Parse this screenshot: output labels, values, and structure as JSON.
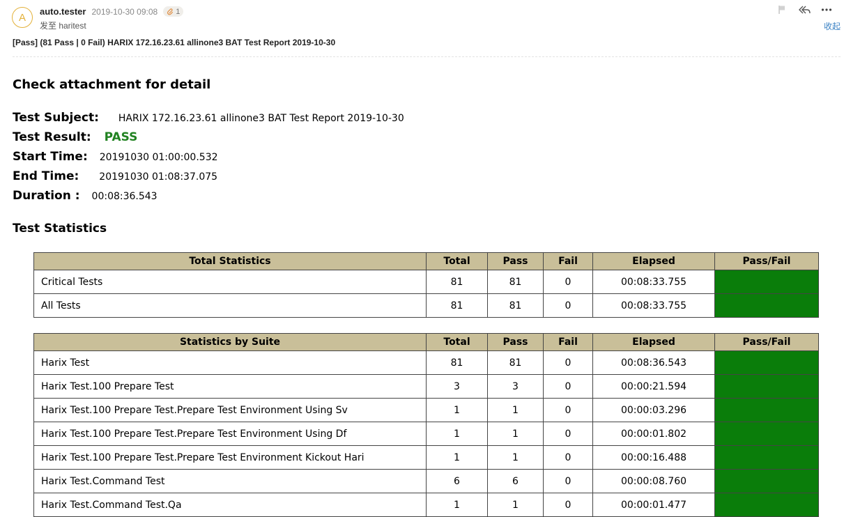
{
  "mail": {
    "avatar_letter": "A",
    "sender": "auto.tester",
    "time": "2019-10-30 09:08",
    "attachment_count": "1",
    "recipient": "发至 haritest",
    "subject": "[Pass] (81 Pass | 0 Fail) HARIX 172.16.23.61 allinone3 BAT Test Report 2019-10-30",
    "collapse_label": "收起",
    "icons": [
      "flag-icon",
      "reply-all-icon",
      "more-icon",
      "paperclip-icon"
    ]
  },
  "report": {
    "heading": "Check attachment for detail",
    "subject_label": "Test Subject:",
    "subject_value": "HARIX 172.16.23.61 allinone3 BAT Test Report 2019-10-30",
    "result_label": "Test Result:",
    "result_value": "PASS",
    "start_label": "Start Time:",
    "start_value": "20191030 01:00:00.532",
    "end_label": "End Time:",
    "end_value": "20191030 01:08:37.075",
    "duration_label": "Duration :",
    "duration_value": "00:08:36.543",
    "stats_heading": "Test Statistics"
  },
  "total_table": {
    "headers": [
      "Total Statistics",
      "Total",
      "Pass",
      "Fail",
      "Elapsed",
      "Pass/Fail"
    ],
    "rows": [
      {
        "name": "Critical Tests",
        "total": "81",
        "pass": "81",
        "fail": "0",
        "elapsed": "00:08:33.755"
      },
      {
        "name": "All Tests",
        "total": "81",
        "pass": "81",
        "fail": "0",
        "elapsed": "00:08:33.755"
      }
    ]
  },
  "suite_table": {
    "headers": [
      "Statistics by Suite",
      "Total",
      "Pass",
      "Fail",
      "Elapsed",
      "Pass/Fail"
    ],
    "rows": [
      {
        "name": "Harix Test",
        "total": "81",
        "pass": "81",
        "fail": "0",
        "elapsed": "00:08:36.543"
      },
      {
        "name": "Harix Test.100 Prepare Test",
        "total": "3",
        "pass": "3",
        "fail": "0",
        "elapsed": "00:00:21.594"
      },
      {
        "name": "Harix Test.100 Prepare Test.Prepare Test Environment Using Sv",
        "total": "1",
        "pass": "1",
        "fail": "0",
        "elapsed": "00:00:03.296"
      },
      {
        "name": "Harix Test.100 Prepare Test.Prepare Test Environment Using Df",
        "total": "1",
        "pass": "1",
        "fail": "0",
        "elapsed": "00:00:01.802"
      },
      {
        "name": "Harix Test.100 Prepare Test.Prepare Test Environment Kickout Hari",
        "total": "1",
        "pass": "1",
        "fail": "0",
        "elapsed": "00:00:16.488"
      },
      {
        "name": "Harix Test.Command Test",
        "total": "6",
        "pass": "6",
        "fail": "0",
        "elapsed": "00:00:08.760"
      },
      {
        "name": "Harix Test.Command Test.Qa",
        "total": "1",
        "pass": "1",
        "fail": "0",
        "elapsed": "00:00:01.477"
      }
    ]
  },
  "colors": {
    "pass_bar": "#0a7d0a",
    "header_bg": "#c9bf99",
    "pass_text": "#218221",
    "avatar": "#e3b13a",
    "link": "#3b82c4"
  }
}
